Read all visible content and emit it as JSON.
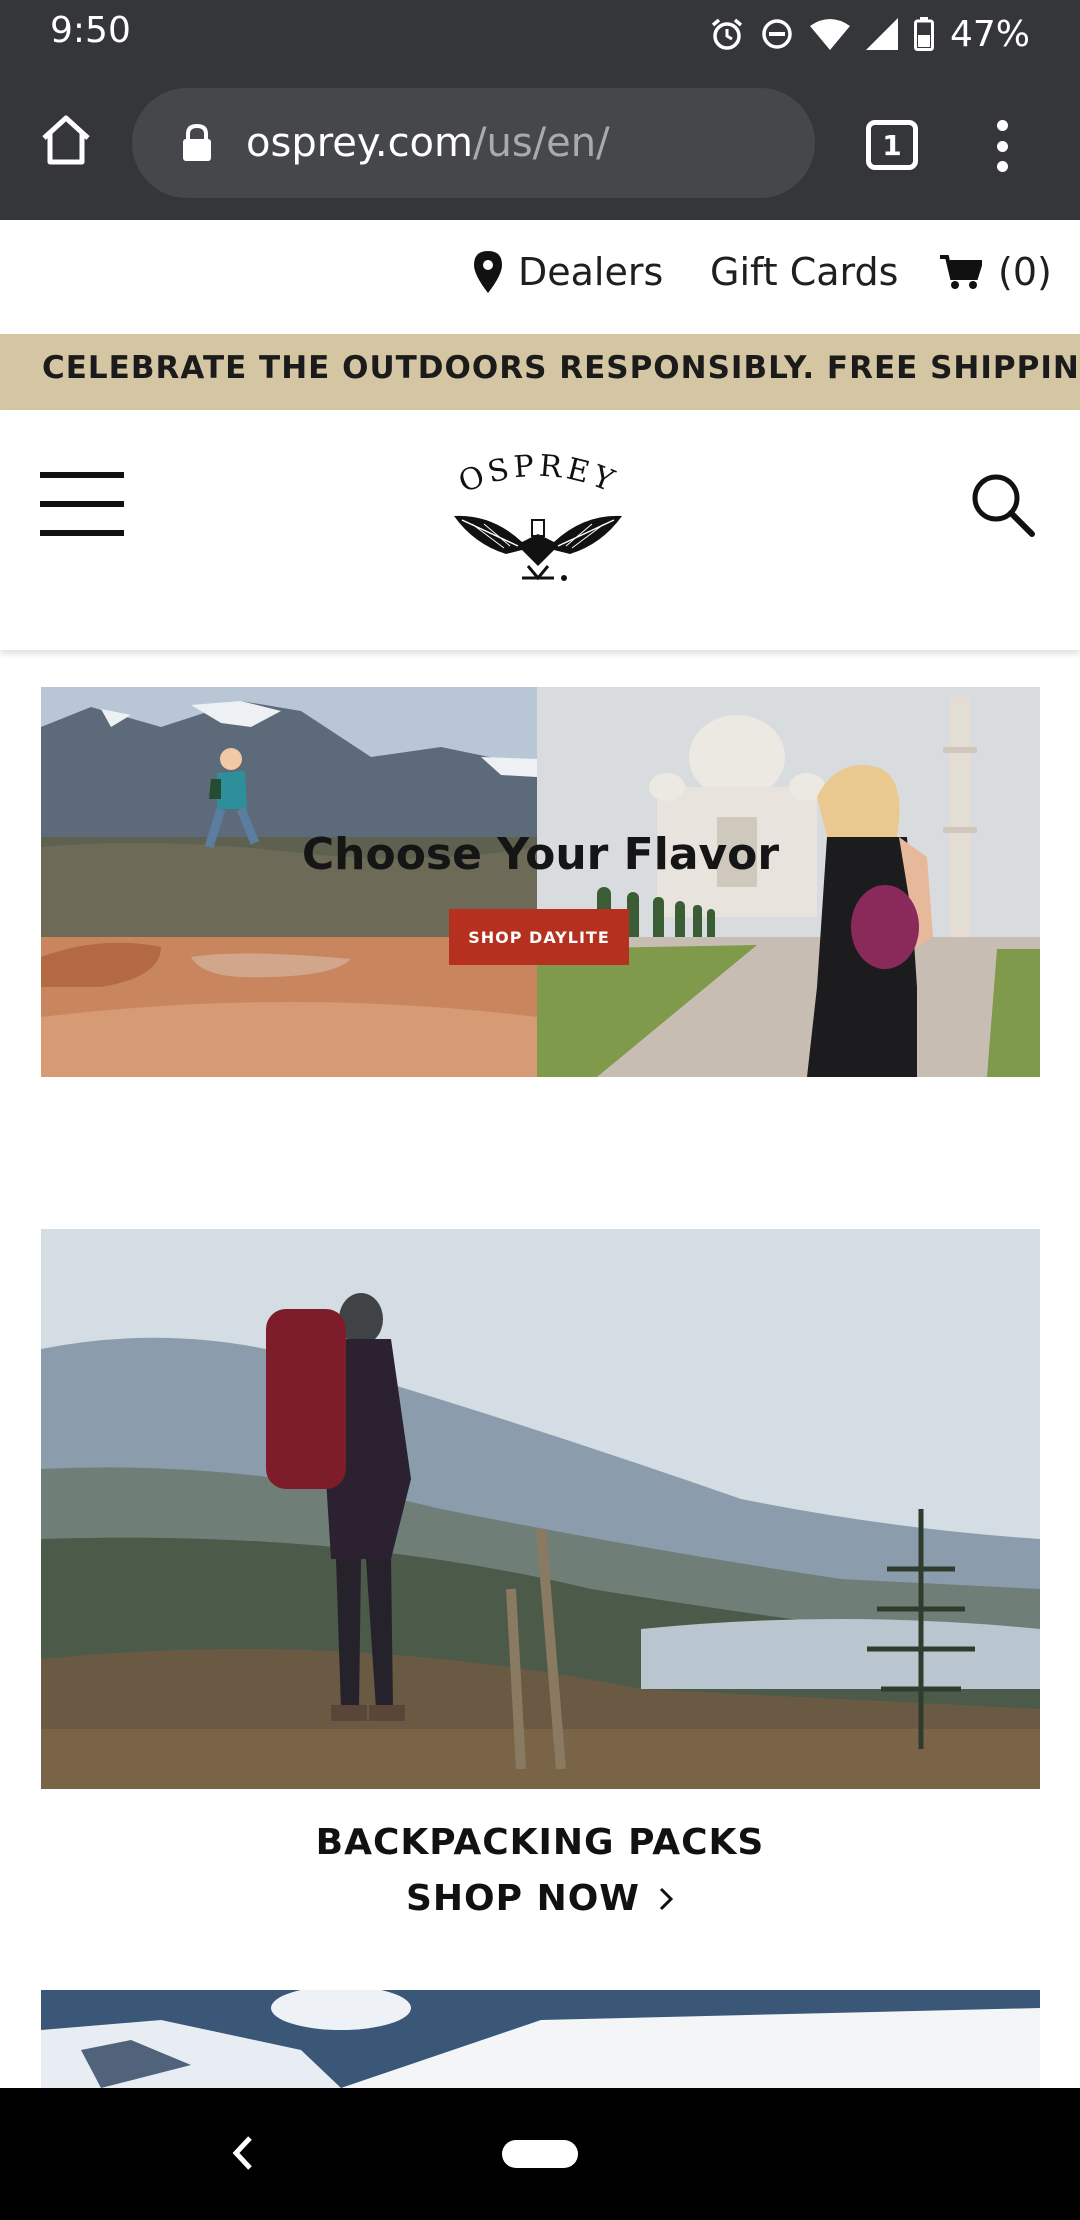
{
  "status_bar": {
    "time": "9:50",
    "battery": "47%",
    "icons": [
      "alarm-icon",
      "do-not-disturb-icon",
      "wifi-icon",
      "signal-icon",
      "battery-icon"
    ]
  },
  "browser": {
    "url_host": "osprey.com",
    "url_path": "/us/en/",
    "tab_count": "1",
    "icons": [
      "home-icon",
      "lock-icon",
      "tabs-icon",
      "more-vert-icon"
    ]
  },
  "utility_nav": {
    "dealers": "Dealers",
    "gift_cards": "Gift Cards",
    "cart": "(0)"
  },
  "promo": {
    "text": "CELEBRATE THE OUTDOORS RESPONSIBLY. FREE SHIPPING &"
  },
  "header": {
    "logo_text": "OSPREY",
    "icons": [
      "hamburger-menu-icon",
      "osprey-logo",
      "search-icon"
    ]
  },
  "hero": {
    "title": "Choose Your Flavor",
    "cta": "SHOP DAYLITE"
  },
  "category_card": {
    "title": "BACKPACKING PACKS",
    "cta": "SHOP NOW"
  },
  "colors": {
    "chrome_bg": "#35363a",
    "omnibox_bg": "#46474b",
    "promo_bg": "#d5c6a3",
    "cta_red": "#b5301f",
    "nav_bar": "#000000"
  }
}
